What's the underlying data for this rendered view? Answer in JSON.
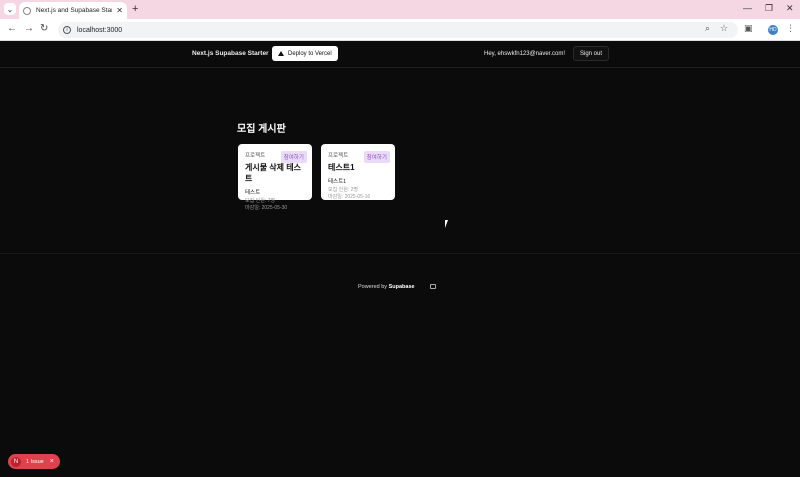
{
  "browser": {
    "tab_title": "Next.js and Supabase Starter Kit",
    "new_tab": "+",
    "url": "localhost:3000"
  },
  "nav": {
    "brand": "Next.js Supabase Starter",
    "deploy_label": "Deploy to Vercel",
    "greeting": "Hey, ehswkfn123@naver.com!",
    "signout_label": "Sign out"
  },
  "main": {
    "heading": "모집 게시판",
    "cards": [
      {
        "category": "프로젝트",
        "badge": "참여하기",
        "title": "게시물 삭제 테스트",
        "desc": "테스트",
        "members": "모집 인원: 7명",
        "deadline": "마감일: 2025-05-30"
      },
      {
        "category": "프로젝트",
        "badge": "참여하기",
        "title": "테스트1",
        "desc": "테스트1",
        "members": "모집 인원: 2명",
        "deadline": "마감일: 2025-05-16"
      }
    ]
  },
  "footer": {
    "powered_by": "Powered by",
    "brand": "Supabase"
  },
  "devtools": {
    "badge_letter": "N",
    "issue_label": "1 Issue",
    "close": "×"
  }
}
